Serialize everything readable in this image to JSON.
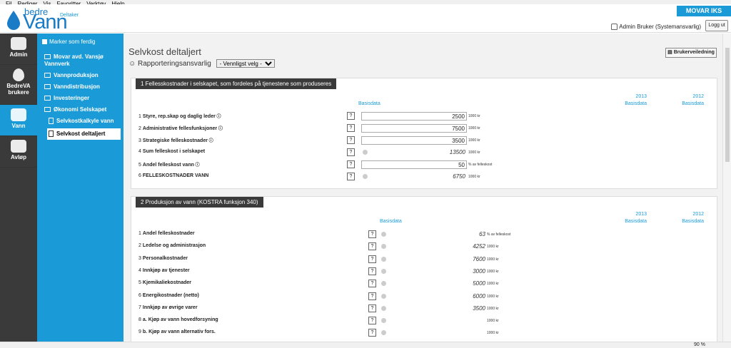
{
  "menubar": [
    "Fil",
    "Rediger",
    "Vis",
    "Favoritter",
    "Verktøy",
    "Hjelp"
  ],
  "app": {
    "logo_top": "bedre",
    "logo_main": "Vann",
    "logo_sub": "Deltaker"
  },
  "header": {
    "company": "MOVAR IKS",
    "user": "Admin Bruker (Systemansvarlig)",
    "logout": "Logg ut"
  },
  "leftnav": [
    {
      "label": "Admin",
      "icon": "admin-icon",
      "active": false
    },
    {
      "label": "BedreVA brukere",
      "icon": "users-icon",
      "active": false
    },
    {
      "label": "Vann",
      "icon": "tap-icon",
      "active": true
    },
    {
      "label": "Avløp",
      "icon": "toilet-icon",
      "active": false
    }
  ],
  "subnav": {
    "marker": "Marker som ferdig",
    "items": [
      {
        "label": "Movar avd. Vansjø Vannverk",
        "type": "folder"
      },
      {
        "label": "Vannproduksjon",
        "type": "folder"
      },
      {
        "label": "Vanndistribusjon",
        "type": "folder"
      },
      {
        "label": "Investeringer",
        "type": "folder"
      },
      {
        "label": "Økonomi Selskapet",
        "type": "folder"
      },
      {
        "label": "Selvkostkalkyle vann",
        "type": "doc"
      },
      {
        "label": "Selvkost deltaljert",
        "type": "doc",
        "selected": true
      }
    ]
  },
  "page": {
    "title": "Selvkost deltaljert",
    "resp_label": "Rapporteringsansvarlig",
    "resp_option": "- Vennligst velg -",
    "guide": "Brukerveiledning"
  },
  "sections": [
    {
      "title": "1  Fellesskostnader i selskapet, som fordeles på tjenestene som produseres",
      "col_basis": "Basisdata",
      "years": [
        "2013",
        "2012"
      ],
      "year_sub": "Basisdata",
      "rows": [
        {
          "num": "1",
          "label": "Styre, rep.skap og daglig leder",
          "value": "2500",
          "unit": "1000 kr",
          "kind": "input",
          "info": true
        },
        {
          "num": "2",
          "label": "Administrative fellesfunksjoner",
          "value": "7500",
          "unit": "1000 kr",
          "kind": "input",
          "info": true
        },
        {
          "num": "3",
          "label": "Strategiske felleskostnader",
          "value": "3500",
          "unit": "1000 kr",
          "kind": "input",
          "info": true
        },
        {
          "num": "4",
          "label": "Sum felleskost i selskapet",
          "value": "13500",
          "unit": "1000 kr",
          "kind": "calc",
          "info": false
        },
        {
          "num": "5",
          "label": "Andel felleskost vann",
          "value": "50",
          "unit": "% av felleskost",
          "kind": "input",
          "info": true
        },
        {
          "num": "6",
          "label": "FELLESKOSTNADER VANN",
          "value": "6750",
          "unit": "1000 kr",
          "kind": "calc",
          "info": false
        }
      ]
    },
    {
      "title": "2  Produksjon av vann (KOSTRA funksjon 340)",
      "col_basis": "Basisdata",
      "years": [
        "2013",
        "2012"
      ],
      "year_sub": "Basisdata",
      "rows": [
        {
          "num": "1",
          "label": "Andel felleskostnader",
          "value": "63",
          "unit": "% av felleskost",
          "kind": "calc"
        },
        {
          "num": "2",
          "label": "Ledelse og administrasjon",
          "value": "4252",
          "unit": "1000 kr",
          "kind": "calc"
        },
        {
          "num": "3",
          "label": "Personalkostnader",
          "value": "7600",
          "unit": "1000 kr",
          "kind": "calc"
        },
        {
          "num": "4",
          "label": "Innkjøp av tjenester",
          "value": "3000",
          "unit": "1000 kr",
          "kind": "calc"
        },
        {
          "num": "5",
          "label": "Kjemikaliekostnader",
          "value": "5000",
          "unit": "1000 kr",
          "kind": "calc"
        },
        {
          "num": "6",
          "label": "Energikostnader (netto)",
          "value": "6000",
          "unit": "1000 kr",
          "kind": "calc"
        },
        {
          "num": "7",
          "label": "Innkjøp av øvrige varer",
          "value": "3500",
          "unit": "1000 kr",
          "kind": "calc"
        },
        {
          "num": "8",
          "label": "a. Kjøp av vann hovedforsyning",
          "value": "",
          "unit": "1000 kr",
          "kind": "calc"
        },
        {
          "num": "9",
          "label": "b. Kjøp av vann alternativ fors.",
          "value": "",
          "unit": "1000 kr",
          "kind": "calc"
        }
      ]
    }
  ],
  "status": {
    "zoom": "90 %"
  }
}
